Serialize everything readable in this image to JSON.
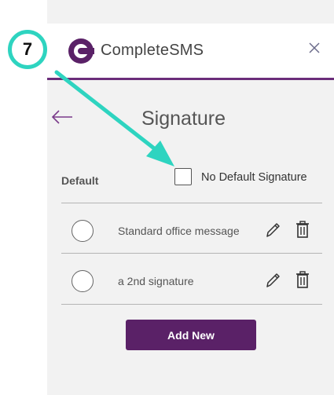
{
  "header": {
    "app_name": "CompleteSMS",
    "brand_color": "#5a2167",
    "accent_line_color": "#6b2d7a"
  },
  "page": {
    "title": "Signature",
    "default_label": "Default",
    "no_default_label": "No Default Signature",
    "no_default_checked": false
  },
  "signatures": [
    {
      "name": "Standard office message",
      "selected": false
    },
    {
      "name": "a 2nd signature",
      "selected": false
    }
  ],
  "buttons": {
    "add_new": "Add New"
  },
  "annotation": {
    "step_number": "7",
    "color": "#2ed4c0"
  },
  "icons": [
    "completesms-logo-icon",
    "close-icon",
    "back-arrow-icon",
    "pencil-icon",
    "trash-icon"
  ]
}
